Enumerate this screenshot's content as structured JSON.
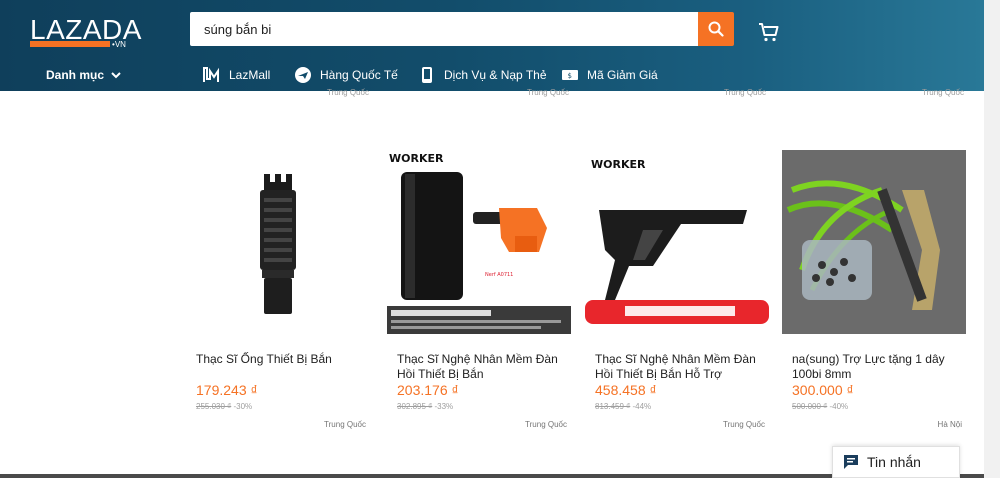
{
  "header": {
    "logo_text": "LAZADA",
    "logo_sub": "VN",
    "search_value": "súng bắn bi",
    "categories_label": "Danh mục",
    "nav": [
      {
        "label": "LazMall",
        "icon": "lazmall-icon"
      },
      {
        "label": "Hàng Quốc Tế",
        "icon": "plane-icon"
      },
      {
        "label": "Dịch Vụ & Nạp Thẻ",
        "icon": "phone-icon"
      },
      {
        "label": "Mã Giảm Giá",
        "icon": "voucher-icon"
      }
    ]
  },
  "previous_row_origins": [
    "Trung Quốc",
    "Trung Quốc",
    "Trung Quốc",
    "Trung Quốc"
  ],
  "products": [
    {
      "title": "Thạc Sĩ Ống Thiết Bị Bắn",
      "price": "179.243 ₫",
      "old_price": "255.030 ₫",
      "discount": "-30%",
      "origin": "Trung Quốc",
      "image": "muzzle-image"
    },
    {
      "title": "Thạc Sĩ Nghệ Nhân Mềm Đàn Hồi Thiết Bị Bắn",
      "price": "203.176 ₫",
      "old_price": "302.895 ₫",
      "discount": "-33%",
      "origin": "Trung Quốc",
      "image": "worker-tube-image",
      "brand": "WORKER"
    },
    {
      "title": "Thạc Sĩ Nghệ Nhân Mềm Đàn Hồi Thiết Bị Bắn Hỗ Trợ",
      "price": "458.458 ₫",
      "old_price": "813.459 ₫",
      "discount": "-44%",
      "origin": "Trung Quốc",
      "image": "worker-stock-image",
      "brand": "WORKER"
    },
    {
      "title": "na(sung) Trợ Lực tặng 1 dây 100bi 8mm",
      "price": "300.000 ₫",
      "old_price": "500.000 ₫",
      "discount": "-40%",
      "origin": "Hà Nội",
      "image": "slingshot-image"
    }
  ],
  "chat": {
    "label": "Tin nhắn"
  },
  "colors": {
    "accent": "#f57224",
    "header_dark": "#0f3f5b",
    "header_light": "#2a7a99"
  }
}
